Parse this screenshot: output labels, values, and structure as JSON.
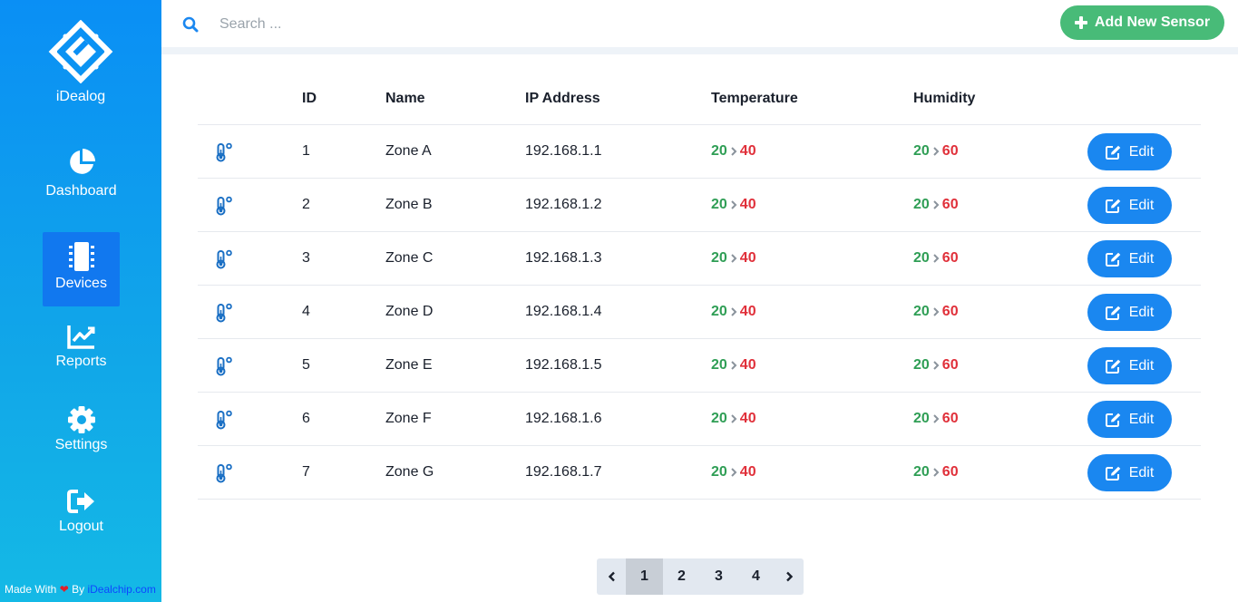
{
  "app": {
    "name": "iDealog"
  },
  "sidebar": {
    "items": [
      {
        "label": "Dashboard",
        "icon": "pie-chart-icon",
        "active": false
      },
      {
        "label": "Devices",
        "icon": "chip-icon",
        "active": true
      },
      {
        "label": "Reports",
        "icon": "line-chart-icon",
        "active": false
      },
      {
        "label": "Settings",
        "icon": "gear-icon",
        "active": false
      },
      {
        "label": "Logout",
        "icon": "logout-icon",
        "active": false
      }
    ],
    "footer": {
      "made_with": "Made With",
      "by": "By",
      "site": "iDealchip.com"
    }
  },
  "topbar": {
    "search_placeholder": "Search ...",
    "add_button_label": "Add New Sensor"
  },
  "table": {
    "headers": {
      "id": "ID",
      "name": "Name",
      "ip": "IP Address",
      "temperature": "Temperature",
      "humidity": "Humidity"
    },
    "edit_label": "Edit",
    "rows": [
      {
        "id": "1",
        "name": "Zone A",
        "ip": "192.168.1.1",
        "temp_min": "20",
        "temp_max": "40",
        "hum_min": "20",
        "hum_max": "60"
      },
      {
        "id": "2",
        "name": "Zone B",
        "ip": "192.168.1.2",
        "temp_min": "20",
        "temp_max": "40",
        "hum_min": "20",
        "hum_max": "60"
      },
      {
        "id": "3",
        "name": "Zone C",
        "ip": "192.168.1.3",
        "temp_min": "20",
        "temp_max": "40",
        "hum_min": "20",
        "hum_max": "60"
      },
      {
        "id": "4",
        "name": "Zone D",
        "ip": "192.168.1.4",
        "temp_min": "20",
        "temp_max": "40",
        "hum_min": "20",
        "hum_max": "60"
      },
      {
        "id": "5",
        "name": "Zone E",
        "ip": "192.168.1.5",
        "temp_min": "20",
        "temp_max": "40",
        "hum_min": "20",
        "hum_max": "60"
      },
      {
        "id": "6",
        "name": "Zone F",
        "ip": "192.168.1.6",
        "temp_min": "20",
        "temp_max": "40",
        "hum_min": "20",
        "hum_max": "60"
      },
      {
        "id": "7",
        "name": "Zone G",
        "ip": "192.168.1.7",
        "temp_min": "20",
        "temp_max": "40",
        "hum_min": "20",
        "hum_max": "60"
      }
    ]
  },
  "pagination": {
    "pages": [
      "1",
      "2",
      "3",
      "4"
    ],
    "current": "1"
  },
  "colors": {
    "accent": "#1a87f0",
    "add": "#48bb78",
    "min": "#2f9e55",
    "max": "#e0303a"
  }
}
